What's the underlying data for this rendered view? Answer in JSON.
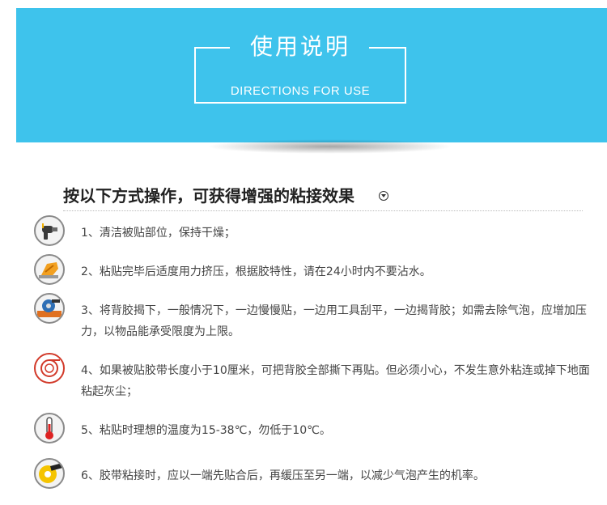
{
  "banner": {
    "title_cn": "使用说明",
    "title_en": "DIRECTIONS FOR USE"
  },
  "heading": "按以下方式操作，可获得增强的粘接效果",
  "steps": [
    {
      "icon": "hair-dryer-icon",
      "text": "1、清洁被贴部位，保持干燥；"
    },
    {
      "icon": "hand-press-icon",
      "text": "2、粘贴完毕后适度用力挤压，根据胶特性，请在24小时内不要沾水。"
    },
    {
      "icon": "tape-apply-icon",
      "text": "3、将背胶揭下，一般情况下，一边慢慢贴，一边用工具刮平，一边揭背胶；如需去除气泡，应增加压力，以物品能承受限度为上限。"
    },
    {
      "icon": "tape-roll-icon",
      "text": "4、如果被贴胶带长度小于10厘米，可把背胶全部撕下再贴。但必须小心，不发生意外粘连或掉下地面粘起灰尘；"
    },
    {
      "icon": "thermometer-icon",
      "text": "5、粘贴时理想的温度为15-38℃，勿低于10℃。"
    },
    {
      "icon": "tape-end-icon",
      "text": "6、胶带粘接时，应以一端先贴合后，再缓压至另一端，以减少气泡产生的机率。"
    }
  ],
  "colors": {
    "banner": "#3ec3ec",
    "text": "#444444",
    "heading": "#222222"
  }
}
